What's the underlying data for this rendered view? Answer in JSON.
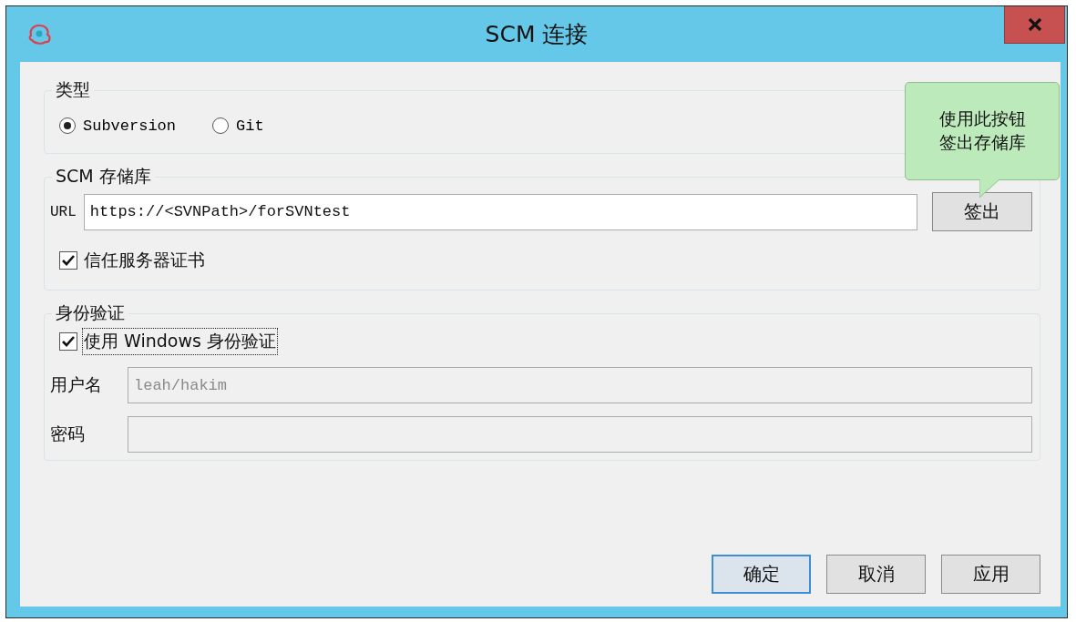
{
  "window": {
    "title": "SCM 连接"
  },
  "tooltip": {
    "lines": [
      "使用此按钮",
      "签出存储库"
    ]
  },
  "type_group": {
    "title": "类型",
    "options": [
      {
        "label": "Subversion",
        "selected": true
      },
      {
        "label": "Git",
        "selected": false
      }
    ]
  },
  "repository_group": {
    "title": "SCM 存储库",
    "url": {
      "label": "URL",
      "value": "https://<SVNPath>/forSVNtest"
    },
    "checkout_button": "签出",
    "trust_certificate": {
      "label": "信任服务器证书",
      "checked": true
    }
  },
  "auth_group": {
    "title": "身份验证",
    "use_windows_auth": {
      "label": "使用 Windows 身份验证",
      "checked": true,
      "focused": true
    },
    "fields": [
      {
        "label": "用户名",
        "value": "leah/hakim",
        "disabled": true
      },
      {
        "label": "密码",
        "disabled": true
      }
    ]
  },
  "buttons": [
    {
      "label": "确定",
      "default": true
    },
    {
      "label": "取消",
      "default": false
    },
    {
      "label": "应用",
      "default": false
    }
  ]
}
